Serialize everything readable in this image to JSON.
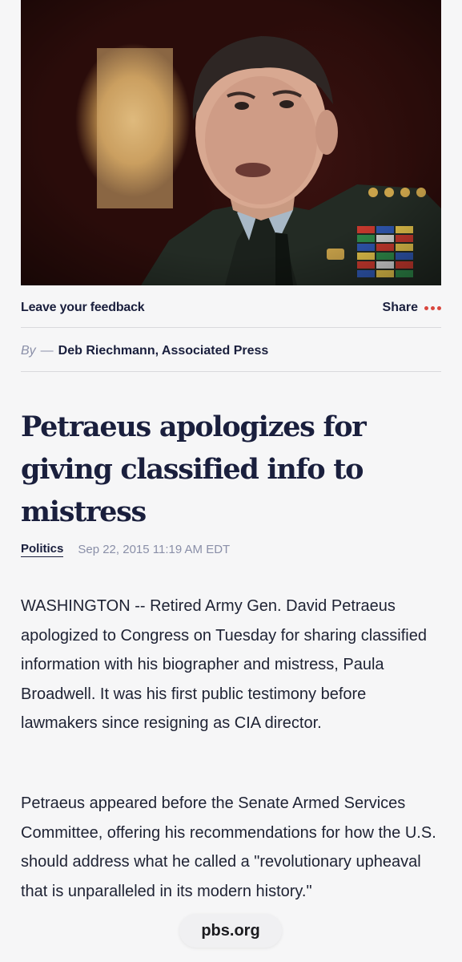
{
  "hero": {
    "image_subject": "photo of a uniformed army general speaking",
    "colors": {
      "uniform": "#2a332b",
      "background": "#5a1a12"
    }
  },
  "actions": {
    "feedback_label": "Leave your feedback",
    "share_label": "Share",
    "more_icon": "more-dots-icon",
    "accent_color": "#d9463e"
  },
  "byline": {
    "prefix": "By",
    "dash": "—",
    "author": "Deb Riechmann, Associated Press"
  },
  "article": {
    "headline": "Petraeus apologizes for giving classified info to mistress",
    "category": "Politics",
    "date": "Sep 22, 2015 11:19 AM EDT",
    "paragraphs": [
      "WASHINGTON -- Retired Army Gen. David Petraeus apologized to Congress on Tuesday for sharing classified information with his biographer and mistress, Paula Broadwell. It was his first public testimony before lawmakers since resigning as CIA director.",
      "Petraeus appeared before the Senate Armed Services Committee, offering his recommendations for how the U.S. should address what he called a \"revolutionary upheaval that is unparalleled in its modern history.\""
    ]
  },
  "browser": {
    "domain": "pbs.org"
  }
}
